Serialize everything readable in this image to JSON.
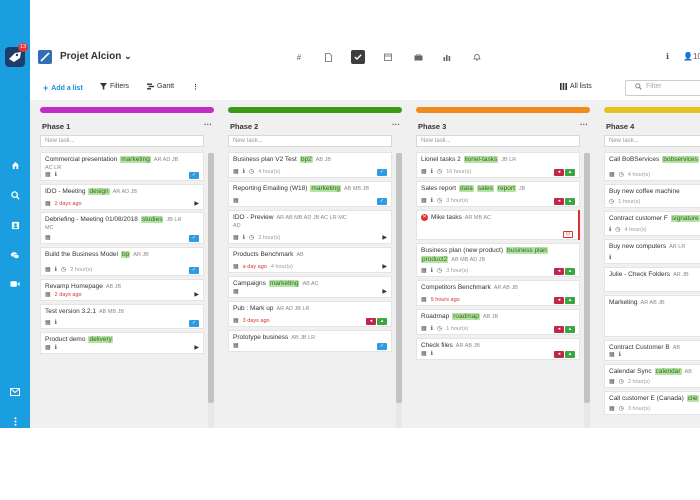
{
  "sidebar": {
    "logo_badge": "13",
    "icons": [
      "home-icon",
      "search-icon",
      "contacts-icon",
      "chat-icon",
      "video-icon",
      "mail-icon",
      "more-icon"
    ]
  },
  "header": {
    "title": "Projet Alcion",
    "chevron": "⌄",
    "right_count": "10",
    "icons": [
      "hash-icon",
      "document-icon",
      "check-icon",
      "calendar-icon",
      "briefcase-icon",
      "chart-icon",
      "bell-icon"
    ]
  },
  "toolbar": {
    "add_list": "Add a list",
    "filters": "Filters",
    "gantt": "Gantt",
    "all_lists": "All lists",
    "filter_placeholder": "Filter"
  },
  "columns": [
    {
      "title": "Phase 1",
      "color": "#c02ec4",
      "new_task_placeholder": "New task...",
      "cards": [
        {
          "title": "Commercial presentation",
          "tags": [
            "marketing"
          ],
          "initials": "AR AD JB",
          "initials2": "AC LR",
          "meta": "",
          "meta_icons": [
            "calendar-icon",
            "info-icon"
          ],
          "badge": "blue"
        },
        {
          "title": "IDO - Meeting",
          "tags": [
            "design"
          ],
          "initials": "AR AD JB",
          "initials2": "",
          "meta": "2 days ago",
          "meta_red": true,
          "meta_icons": [
            "calendar-icon"
          ],
          "badge": "play"
        },
        {
          "title": "Debriefing - Meeting 01/08/2018",
          "tags": [
            "studies"
          ],
          "initials": "JB LR",
          "initials2": "MC",
          "meta": "",
          "meta_icons": [
            "calendar-icon"
          ],
          "badge": "blue"
        },
        {
          "title": "Build the Business Model",
          "tags": [
            "bp"
          ],
          "initials": "AR JB",
          "initials2": "",
          "meta": "2 hour(s)",
          "meta_icons": [
            "calendar-icon",
            "info-icon",
            "clock-icon"
          ],
          "badge": "blue"
        },
        {
          "title": "Revamp Homepage",
          "tags": [],
          "initials": "AB JB",
          "initials2": "",
          "meta": "2 days ago",
          "meta_red": true,
          "meta_icons": [
            "calendar-icon"
          ],
          "badge": "play"
        },
        {
          "title": "Test version 3.2.1",
          "tags": [],
          "initials": "AB MB JB",
          "initials2": "",
          "meta": "",
          "meta_icons": [
            "calendar-icon",
            "info-icon"
          ],
          "badge": "blue"
        },
        {
          "title": "Product demo",
          "tags": [
            "delivery"
          ],
          "initials": "",
          "initials2": "",
          "meta": "",
          "meta_icons": [
            "calendar-icon",
            "info-icon"
          ],
          "badge": "play"
        }
      ]
    },
    {
      "title": "Phase 2",
      "color": "#3d9a19",
      "new_task_placeholder": "New task...",
      "cards": [
        {
          "title": "Business plan V2 Test",
          "tags": [
            "bp2"
          ],
          "initials": "AB JB",
          "initials2": "",
          "meta": "4 hour(s)",
          "meta_icons": [
            "calendar-icon",
            "info-icon",
            "clock-icon"
          ],
          "badge": "blue"
        },
        {
          "title": "Reporting Emailing (W18)",
          "tags": [
            "marketing"
          ],
          "initials": "AB MB JB",
          "initials2": "",
          "meta": "",
          "meta_icons": [
            "calendar-icon"
          ],
          "badge": "blue"
        },
        {
          "title": "IDO - Preview",
          "tags": [],
          "initials": "AR AB MB AD JB AC LR MC",
          "initials2": "AD",
          "meta": "3 hour(s)",
          "meta_icons": [
            "calendar-icon",
            "info-icon",
            "clock-icon"
          ],
          "badge": "play"
        },
        {
          "title": "Products Benchmark",
          "tags": [],
          "initials": "AB",
          "initials2": "",
          "meta": "a day ago",
          "meta_red": true,
          "meta_extra": "4 hour(s)",
          "meta_icons": [
            "calendar-icon"
          ],
          "badge": "play"
        },
        {
          "title": "Campaigns",
          "tags": [
            "marketing"
          ],
          "initials": "AB AC",
          "initials2": "",
          "meta": "",
          "meta_icons": [
            "calendar-icon"
          ],
          "badge": "play"
        },
        {
          "title": "Pub : Mark up",
          "tags": [],
          "initials": "AR AD JB LR",
          "initials2": "",
          "meta": "3 days ago",
          "meta_red": true,
          "meta_icons": [
            "calendar-icon"
          ],
          "badge": "pair"
        },
        {
          "title": "Prototype business",
          "tags": [],
          "initials": "AB JB LR",
          "initials2": "",
          "meta": "",
          "meta_icons": [
            "calendar-icon"
          ],
          "badge": "blue"
        }
      ]
    },
    {
      "title": "Phase 3",
      "color": "#f08c1e",
      "new_task_placeholder": "New task...",
      "cards": [
        {
          "title": "Lionel tasks 2",
          "tags": [
            "lionel-tasks"
          ],
          "initials": "JB LR",
          "initials2": "",
          "meta": "16 hour(s)",
          "meta_icons": [
            "calendar-icon",
            "info-icon",
            "clock-icon"
          ],
          "badge": "pair"
        },
        {
          "title": "Sales report",
          "tags": [
            "data",
            "sales",
            "report"
          ],
          "initials": "JB",
          "initials2": "",
          "meta": "3 hour(s)",
          "meta_icons": [
            "calendar-icon",
            "info-icon",
            "clock-icon"
          ],
          "badge": "pair"
        },
        {
          "title": "Mike tasks",
          "tags": [],
          "initials": "AR MB AC",
          "initials2": "",
          "meta": "",
          "meta_icons": [],
          "badge": "red-outline",
          "stop": true
        },
        {
          "title": "Business plan (new product)",
          "tags": [
            "business plan"
          ],
          "tags2": [
            "product2"
          ],
          "initials2": "AB MB AD JB",
          "initials": "",
          "meta": "3 hour(s)",
          "meta_icons": [
            "calendar-icon",
            "info-icon",
            "clock-icon"
          ],
          "badge": "pair"
        },
        {
          "title": "Competitors Benchmark",
          "tags": [],
          "initials": "AR AB JB",
          "initials2": "",
          "meta": "9 hours ago",
          "meta_red": true,
          "meta_icons": [
            "calendar-icon"
          ],
          "badge": "pair"
        },
        {
          "title": "Roadmap",
          "tags": [
            "roadmap"
          ],
          "initials": "AB JB",
          "initials2": "",
          "meta": "1 hour(s)",
          "meta_icons": [
            "calendar-icon",
            "info-icon",
            "clock-icon"
          ],
          "badge": "pair"
        },
        {
          "title": "Check files",
          "tags": [],
          "initials": "AR AB JB",
          "initials2": "",
          "meta": "",
          "meta_icons": [
            "calendar-icon",
            "info-icon"
          ],
          "badge": "pair"
        }
      ]
    },
    {
      "title": "Phase 4",
      "color": "#e6c21e",
      "new_task_placeholder": "New task...",
      "cards": [
        {
          "title": "Call BoBServices",
          "tags": [
            "bobservices"
          ],
          "initials": "",
          "initials2": "",
          "meta": "4 hour(s)",
          "meta_icons": [
            "calendar-icon",
            "clock-icon"
          ],
          "badge": ""
        },
        {
          "title": "Buy new coffee machine",
          "tags": [],
          "initials": "",
          "initials2": "",
          "meta": "1 hour(s)",
          "meta_icons": [
            "clock-icon"
          ],
          "badge": ""
        },
        {
          "title": "Contract customer F",
          "tags": [
            "signature"
          ],
          "initials": "",
          "initials2": "",
          "meta": "4 hour(s)",
          "meta_icons": [
            "info-icon",
            "clock-icon"
          ],
          "badge": ""
        },
        {
          "title": "Buy new computers",
          "tags": [],
          "initials": "AR LR",
          "initials2": "",
          "meta": "",
          "meta_icons": [
            "info-icon"
          ],
          "badge": ""
        },
        {
          "title": "Julie - Check Folders",
          "tags": [],
          "initials": "AR JB",
          "initials2": "",
          "meta": "",
          "meta_icons": [],
          "badge": ""
        },
        {
          "title": "Marketing",
          "tags": [],
          "initials": "AR AB JB",
          "initials2": "",
          "meta": "",
          "meta_icons": [],
          "badge": ""
        },
        {
          "title": "Contract Customer B",
          "tags": [],
          "initials": "AB",
          "initials2": "",
          "meta": "",
          "meta_icons": [
            "calendar-icon",
            "info-icon"
          ],
          "badge": ""
        },
        {
          "title": "Calendar Sync",
          "tags": [
            "calendar"
          ],
          "initials": "AB",
          "initials2": "",
          "meta": "2 hour(s)",
          "meta_icons": [
            "calendar-icon",
            "clock-icon"
          ],
          "badge": ""
        },
        {
          "title": "Call customer E (Canada)",
          "tags": [
            "clie"
          ],
          "initials": "",
          "initials2": "",
          "meta": "3 hour(s)",
          "meta_icons": [
            "calendar-icon",
            "clock-icon"
          ],
          "badge": ""
        }
      ]
    }
  ]
}
